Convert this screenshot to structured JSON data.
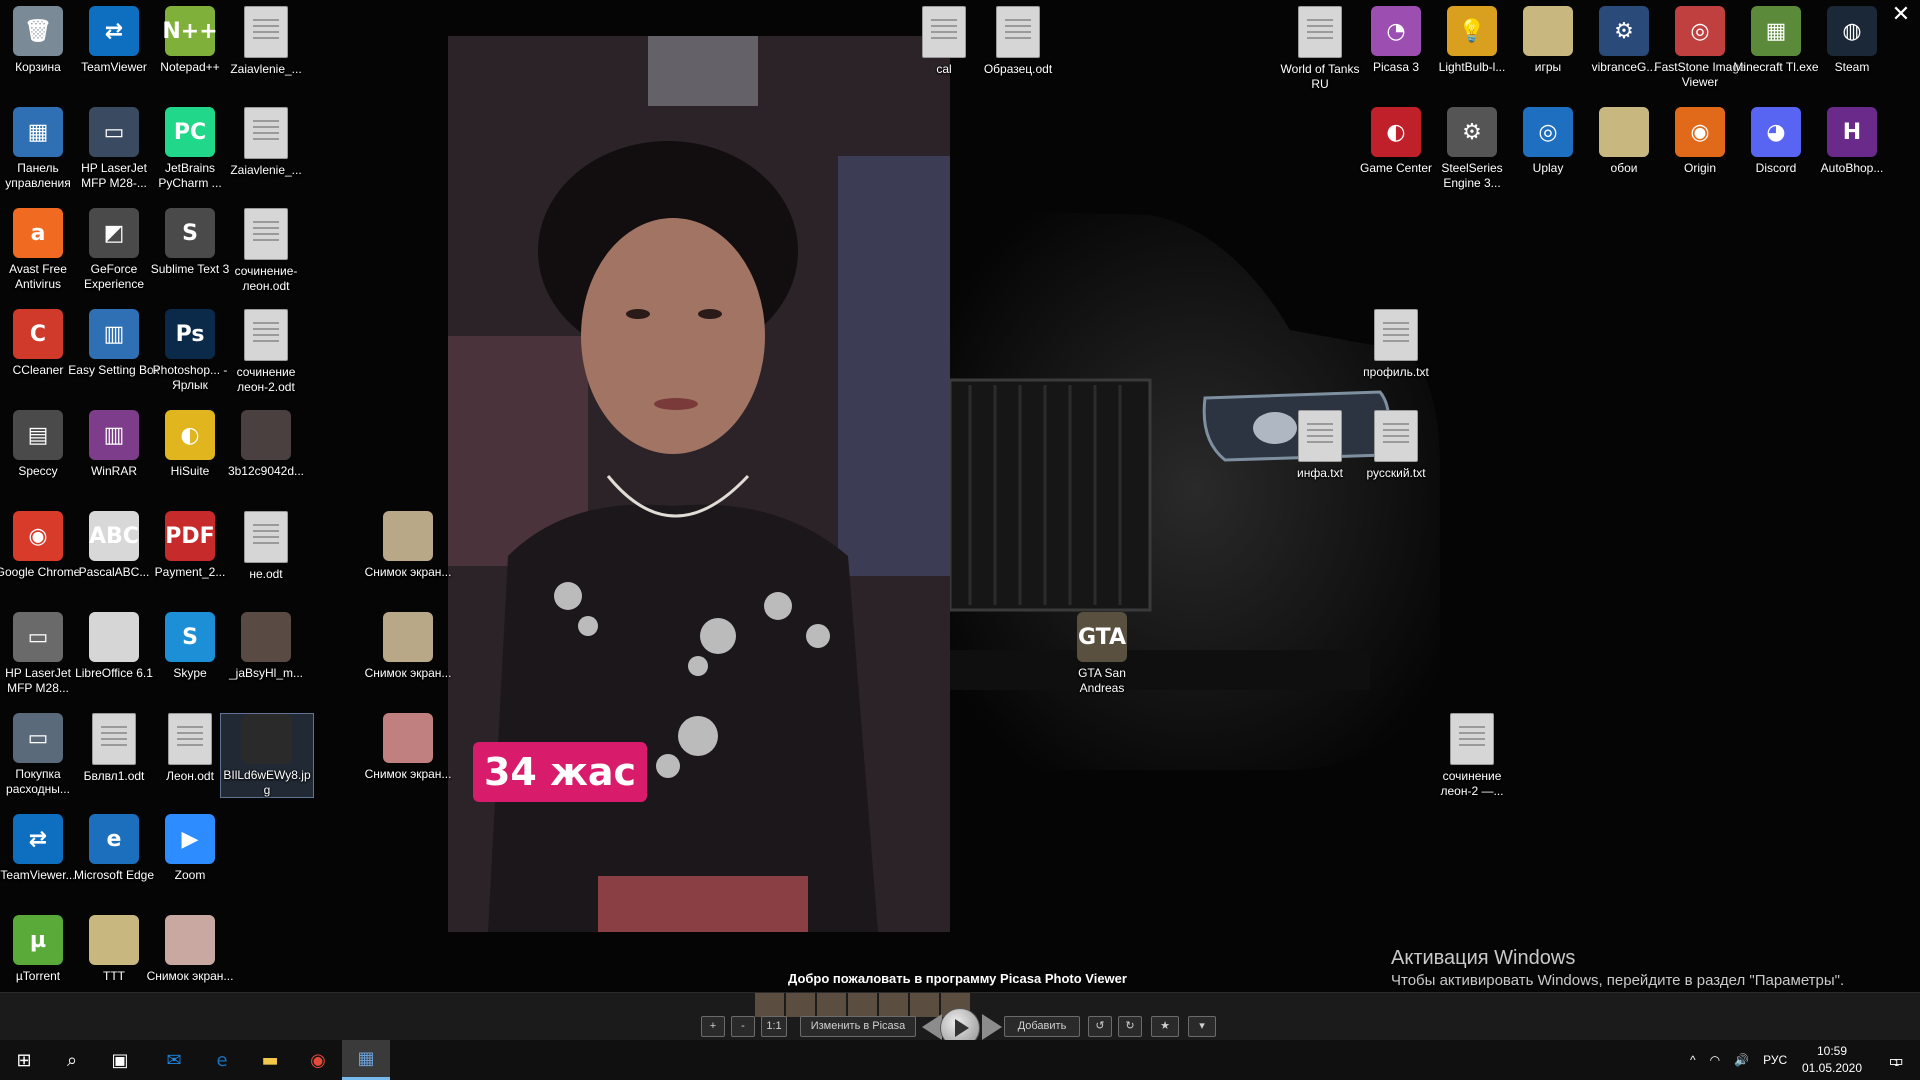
{
  "desktop": {
    "icons": [
      {
        "label": "Корзина",
        "icon": "recycle-bin-icon",
        "color": "#7a8a96",
        "text": "🗑"
      },
      {
        "label": "TeamViewer",
        "icon": "teamviewer-icon",
        "color": "#0e6fc0",
        "text": "⇄"
      },
      {
        "label": "Notepad++",
        "icon": "notepadpp-icon",
        "color": "#7fb13a",
        "text": "N++"
      },
      {
        "label": "Zaiavlenie_...",
        "icon": "document-icon",
        "color": "#d6d6d6",
        "text": ""
      },
      {
        "label": "Панель управления",
        "icon": "control-panel-icon",
        "color": "#2f6fb3",
        "text": "▦"
      },
      {
        "label": "HP LaserJet MFP M28-...",
        "icon": "scanner-icon",
        "color": "#3a4a60",
        "text": "▭"
      },
      {
        "label": "JetBrains PyCharm ...",
        "icon": "pycharm-icon",
        "color": "#21d789",
        "text": "PC"
      },
      {
        "label": "Zaiavlenie_...",
        "icon": "document-icon",
        "color": "#d6d6d6",
        "text": ""
      },
      {
        "label": "Avast Free Antivirus",
        "icon": "avast-icon",
        "color": "#f06a22",
        "text": "a"
      },
      {
        "label": "GeForce Experience",
        "icon": "geforce-icon",
        "color": "#4a4a4a",
        "text": "◩"
      },
      {
        "label": "Sublime Text 3",
        "icon": "sublime-icon",
        "color": "#4a4a4a",
        "text": "S"
      },
      {
        "label": "сочинение-леон.odt",
        "icon": "document-icon",
        "color": "#d6d6d6",
        "text": ""
      },
      {
        "label": "CCleaner",
        "icon": "ccleaner-icon",
        "color": "#d03a2b",
        "text": "C"
      },
      {
        "label": "Easy Setting Box",
        "icon": "easy-setting-icon",
        "color": "#2f6fb3",
        "text": "▥"
      },
      {
        "label": "Photoshop... - Ярлык",
        "icon": "photoshop-icon",
        "color": "#0b2a4a",
        "text": "Ps"
      },
      {
        "label": "сочинение леон-2.odt",
        "icon": "document-icon",
        "color": "#d6d6d6",
        "text": ""
      },
      {
        "label": "Speccy",
        "icon": "speccy-icon",
        "color": "#4a4a4a",
        "text": "▤"
      },
      {
        "label": "WinRAR",
        "icon": "winrar-icon",
        "color": "#7d3d8a",
        "text": "▥"
      },
      {
        "label": "HiSuite",
        "icon": "hisuite-icon",
        "color": "#e0b51e",
        "text": "◐"
      },
      {
        "label": "3b12c9042d...",
        "icon": "image-thumbnail-icon",
        "color": "#4a4040",
        "text": ""
      },
      {
        "label": "Google Chrome",
        "icon": "chrome-icon",
        "color": "#d93b2b",
        "text": "◉"
      },
      {
        "label": "PascalABC...",
        "icon": "pascalabc-icon",
        "color": "#d8d8d8",
        "text": "ABC"
      },
      {
        "label": "Payment_2...",
        "icon": "pdf-icon",
        "color": "#c72a2a",
        "text": "PDF"
      },
      {
        "label": "не.odt",
        "icon": "document-icon",
        "color": "#d6d6d6",
        "text": ""
      },
      {
        "label": "HP LaserJet MFP M28...",
        "icon": "printer-icon",
        "color": "#6a6a6a",
        "text": "▭"
      },
      {
        "label": "LibreOffice 6.1",
        "icon": "libreoffice-icon",
        "color": "#d6d6d6",
        "text": ""
      },
      {
        "label": "Skype",
        "icon": "skype-icon",
        "color": "#1d8fd6",
        "text": "S"
      },
      {
        "label": "_jaBsyHl_m...",
        "icon": "image-thumbnail-icon",
        "color": "#5a4a44",
        "text": ""
      },
      {
        "label": "Покупка расходны...",
        "icon": "purchase-icon",
        "color": "#5a6a7a",
        "text": "▭"
      },
      {
        "label": "Бвлвл1.odt",
        "icon": "document-icon",
        "color": "#d6d6d6",
        "text": ""
      },
      {
        "label": "Леон.odt",
        "icon": "document-icon",
        "color": "#d6d6d6",
        "text": ""
      },
      {
        "label": "BIlLd6wEWy8.jpg",
        "icon": "image-thumbnail-icon",
        "color": "#2a2a2a",
        "text": ""
      },
      {
        "label": "TeamViewer...",
        "icon": "teamviewer-icon",
        "color": "#0e6fc0",
        "text": "⇄"
      },
      {
        "label": "Microsoft Edge",
        "icon": "edge-icon",
        "color": "#1b6fbd",
        "text": "e"
      },
      {
        "label": "Zoom",
        "icon": "zoom-icon",
        "color": "#2d8cff",
        "text": "▶"
      },
      {
        "label": "µTorrent",
        "icon": "utorrent-icon",
        "color": "#5aaa3a",
        "text": "µ"
      },
      {
        "label": "TTT",
        "icon": "folder-zip-icon",
        "color": "#c8b880",
        "text": ""
      },
      {
        "label": "Снимок экран...",
        "icon": "image-thumbnail-icon",
        "color": "#c8a8a0",
        "text": ""
      },
      {
        "label": "Снимок экран...",
        "icon": "image-thumbnail-icon",
        "color": "#b8a888",
        "text": ""
      },
      {
        "label": "Снимок экран...",
        "icon": "image-thumbnail-icon",
        "color": "#b8a888",
        "text": ""
      },
      {
        "label": "Снимок экран...",
        "icon": "image-thumbnail-icon",
        "color": "#c08080",
        "text": ""
      },
      {
        "label": "cal",
        "icon": "document-icon",
        "color": "#d6d6d6",
        "text": ""
      },
      {
        "label": "Образец.odt",
        "icon": "document-icon",
        "color": "#d6d6d6",
        "text": ""
      },
      {
        "label": "World of Tanks RU",
        "icon": "document-icon",
        "color": "#d6d6d6",
        "text": ""
      },
      {
        "label": "Picasa 3",
        "icon": "picasa-icon",
        "color": "#9c4fb0",
        "text": "◔"
      },
      {
        "label": "LightBulb-l...",
        "icon": "lightbulb-icon",
        "color": "#d9a020",
        "text": "💡"
      },
      {
        "label": "игры",
        "icon": "folder-icon",
        "color": "#c8b880",
        "text": ""
      },
      {
        "label": "vibranceG...",
        "icon": "gear-icon",
        "color": "#2a4a7a",
        "text": "⚙"
      },
      {
        "label": "FastStone Image Viewer",
        "icon": "faststone-icon",
        "color": "#c04040",
        "text": "◎"
      },
      {
        "label": "Minecraft Tl.exe",
        "icon": "minecraft-icon",
        "color": "#5a8a3a",
        "text": "▦"
      },
      {
        "label": "Steam",
        "icon": "steam-icon",
        "color": "#1b2838",
        "text": "◍"
      },
      {
        "label": "Game Center",
        "icon": "game-center-icon",
        "color": "#c0202a",
        "text": "◐"
      },
      {
        "label": "SteelSeries Engine 3...",
        "icon": "steelseries-icon",
        "color": "#555555",
        "text": "⚙"
      },
      {
        "label": "Uplay",
        "icon": "uplay-icon",
        "color": "#1e6fc0",
        "text": "◎"
      },
      {
        "label": "обои",
        "icon": "folder-icon",
        "color": "#c8b880",
        "text": ""
      },
      {
        "label": "Origin",
        "icon": "origin-icon",
        "color": "#e06a1a",
        "text": "◉"
      },
      {
        "label": "Discord",
        "icon": "discord-icon",
        "color": "#5865f2",
        "text": "◕"
      },
      {
        "label": "AutoBhop...",
        "icon": "autobhop-icon",
        "color": "#6a2a8a",
        "text": "H"
      },
      {
        "label": "профиль.txt",
        "icon": "text-file-icon",
        "color": "#d6d6d6",
        "text": ""
      },
      {
        "label": "инфа.txt",
        "icon": "text-file-icon",
        "color": "#d6d6d6",
        "text": ""
      },
      {
        "label": "русский.txt",
        "icon": "text-file-icon",
        "color": "#d6d6d6",
        "text": ""
      },
      {
        "label": "GTA San Andreas",
        "icon": "gta-icon",
        "color": "#5a5040",
        "text": "GTA"
      },
      {
        "label": "сочинение леон-2 —...",
        "icon": "document-icon",
        "color": "#d6d6d6",
        "text": ""
      }
    ]
  },
  "viewer": {
    "photo_caption": "34 жас",
    "close_glyph": "✕",
    "welcome": "Добро пожаловать в программу Picasa Photo Viewer",
    "buttons": {
      "zoom_in": "+",
      "zoom_out": "-",
      "actual_size": "1:1",
      "edit": "Изменить в Picasa",
      "add": "Добавить",
      "rotate_left": "↺",
      "rotate_right": "↻",
      "star": "★",
      "more": "▾"
    }
  },
  "watermark": {
    "title": "Активация Windows",
    "subtitle": "Чтобы активировать Windows, перейдите в раздел \"Параметры\"."
  },
  "taskbar": {
    "start": "⊞",
    "search": "⌕",
    "task_view": "▣",
    "apps": [
      {
        "name": "mail",
        "glyph": "✉",
        "color": "#1e88e5"
      },
      {
        "name": "edge",
        "glyph": "e",
        "color": "#1b6fbd"
      },
      {
        "name": "explorer",
        "glyph": "▬",
        "color": "#f2c94c"
      },
      {
        "name": "chrome",
        "glyph": "◉",
        "color": "#e24a3a"
      },
      {
        "name": "picasa-viewer",
        "glyph": "▦",
        "color": "#6aa0d8"
      }
    ],
    "tray": {
      "chevron": "^",
      "network": "◠",
      "volume": "🔊",
      "lang": "РУС"
    },
    "time": "10:59",
    "date": "01.05.2020",
    "notif_glyph": "▭",
    "notif_count": "1"
  }
}
